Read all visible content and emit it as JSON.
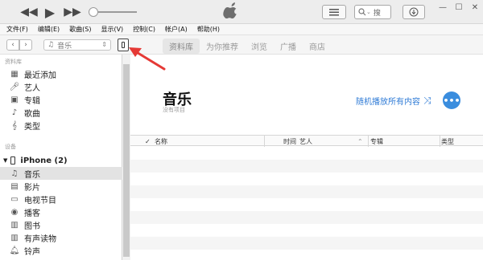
{
  "player": {
    "rewind_icon": "rewind-icon",
    "play_icon": "play-icon",
    "forward_icon": "fast-forward-icon",
    "volume_level": 0.05,
    "search_placeholder": "搜"
  },
  "menu": [
    "文件(F)",
    "编辑(E)",
    "歌曲(S)",
    "显示(V)",
    "控制(C)",
    "帐户(A)",
    "帮助(H)"
  ],
  "nav": {
    "media_select": "音乐",
    "tabs": [
      {
        "label": "资料库",
        "active": true
      },
      {
        "label": "为你推荐",
        "active": false
      },
      {
        "label": "浏览",
        "active": false
      },
      {
        "label": "广播",
        "active": false
      },
      {
        "label": "商店",
        "active": false
      }
    ]
  },
  "sidebar": {
    "library_header": "资料库",
    "library_items": [
      {
        "label": "最近添加",
        "icon": "grid-icon"
      },
      {
        "label": "艺人",
        "icon": "microphone-icon"
      },
      {
        "label": "专辑",
        "icon": "album-icon"
      },
      {
        "label": "歌曲",
        "icon": "music-note-icon"
      },
      {
        "label": "类型",
        "icon": "genre-icon"
      }
    ],
    "devices_header": "设备",
    "device_name": "iPhone (2)",
    "device_items": [
      {
        "label": "音乐",
        "icon": "music-note-icon",
        "selected": true
      },
      {
        "label": "影片",
        "icon": "film-icon",
        "selected": false
      },
      {
        "label": "电视节目",
        "icon": "tv-icon",
        "selected": false
      },
      {
        "label": "播客",
        "icon": "podcast-icon",
        "selected": false
      },
      {
        "label": "图书",
        "icon": "book-icon",
        "selected": false
      },
      {
        "label": "有声读物",
        "icon": "audiobook-icon",
        "selected": false
      },
      {
        "label": "铃声",
        "icon": "bell-icon",
        "selected": false
      }
    ]
  },
  "main": {
    "title": "音乐",
    "subtitle": "没有项目",
    "shuffle_label": "随机播放所有内容",
    "more_label": "•••",
    "columns": {
      "check": "✓",
      "name": "名称",
      "time": "时间",
      "artist": "艺人",
      "album": "专辑",
      "genre": "类型"
    }
  },
  "colors": {
    "accent": "#2f7bd6",
    "annotation": "#e53935"
  }
}
